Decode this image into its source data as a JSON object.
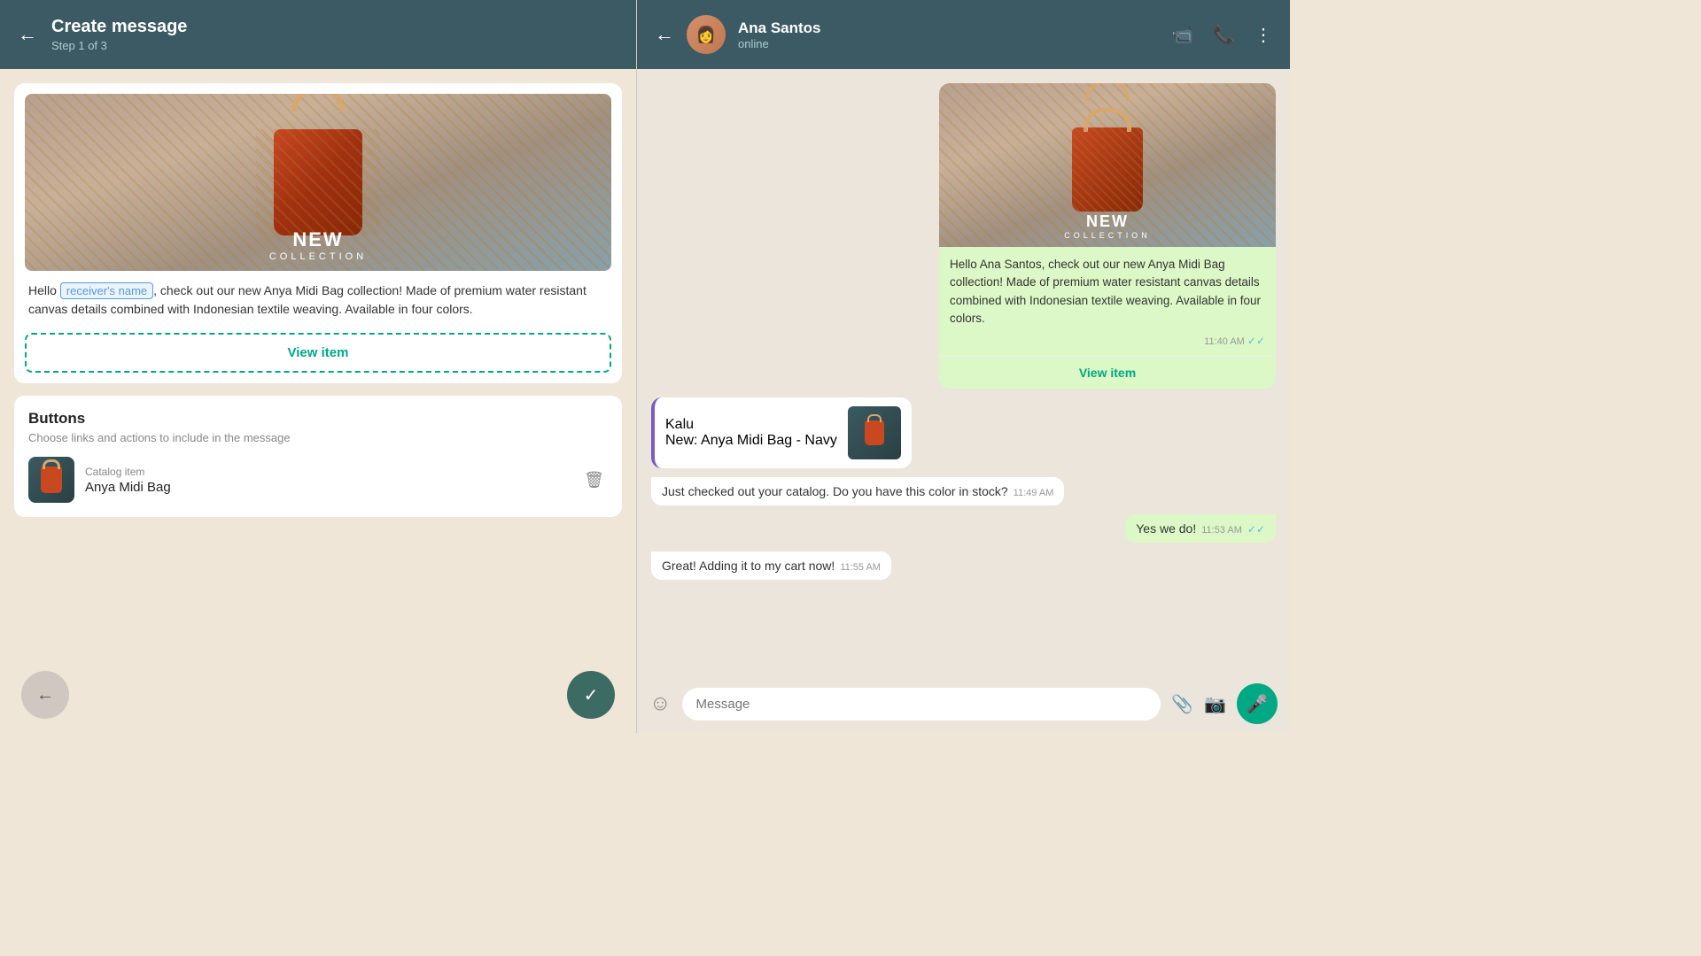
{
  "left": {
    "header": {
      "title": "Create message",
      "step": "Step 1 of 3",
      "back_label": "←"
    },
    "preview": {
      "collection_big": "NEW",
      "collection_small": "COLLECTION",
      "message_intro": "Hello ",
      "receiver_badge": "receiver's name",
      "message_body": ", check out our new Anya Midi Bag collection! Made of premium water resistant canvas details combined with Indonesian textile weaving. Available in four colors.",
      "view_item_label": "View item"
    },
    "buttons_section": {
      "title": "Buttons",
      "subtitle": "Choose links and actions to include in the message",
      "catalog_item": {
        "type": "Catalog item",
        "name": "Anya Midi Bag"
      }
    },
    "footer": {
      "back_label": "←",
      "confirm_label": "✓"
    }
  },
  "right": {
    "header": {
      "contact_name": "Ana Santos",
      "status": "online",
      "back_label": "←",
      "video_icon": "📹",
      "phone_icon": "📞",
      "more_icon": "⋮"
    },
    "chat": {
      "collection_big": "NEW",
      "collection_small": "COLLECTION",
      "sent_card_text": "Hello Ana Santos, check out our new Anya Midi Bag collection! Made of premium water resistant canvas details combined with Indonesian textile weaving. Available in four colors.",
      "sent_card_time": "11:40 AM",
      "sent_card_view_item": "View item",
      "catalog_sender": "Kalu",
      "catalog_product": "New: Anya Midi Bag - Navy",
      "message1": "Just checked out your catalog. Do you have this color in stock?",
      "message1_time": "11:49 AM",
      "message2": "Yes we do!",
      "message2_time": "11:53 AM",
      "message3": "Great! Adding it to my cart now!",
      "message3_time": "11:55 AM",
      "input_placeholder": "Message"
    }
  }
}
